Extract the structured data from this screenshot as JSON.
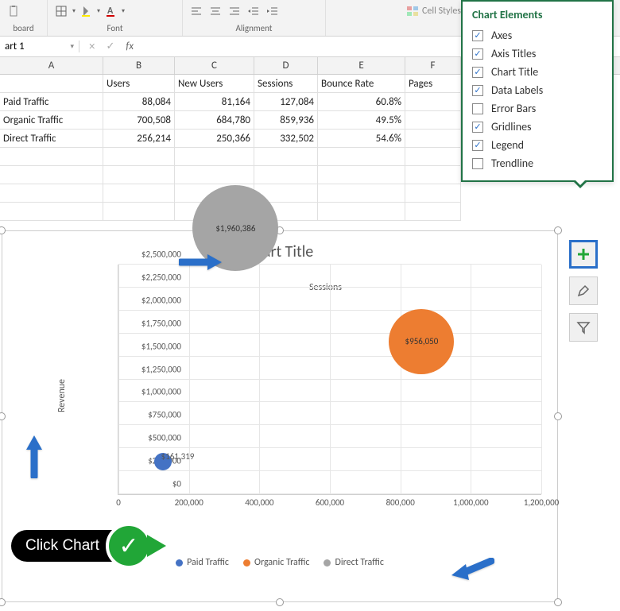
{
  "ribbon": {
    "group1_label": "board",
    "group2_label": "Font",
    "group3_label": "Alignment",
    "cell_styles_label": "Cell Styles"
  },
  "formula_bar": {
    "name_box": "art 1",
    "fx_label": "fx"
  },
  "columns": [
    "A",
    "B",
    "C",
    "D",
    "E",
    "F"
  ],
  "table": {
    "headers": [
      "",
      "Users",
      "New Users",
      "Sessions",
      "Bounce Rate",
      "Pages"
    ],
    "rows": [
      [
        "Paid Traffic",
        "88,084",
        "81,164",
        "127,084",
        "60.8%",
        ""
      ],
      [
        "Organic Traffic",
        "700,508",
        "684,780",
        "859,936",
        "49.5%",
        ""
      ],
      [
        "Direct Traffic",
        "256,214",
        "250,366",
        "332,502",
        "54.6%",
        ""
      ]
    ]
  },
  "flyout": {
    "title": "Chart Elements",
    "items": [
      {
        "label": "Axes",
        "checked": true
      },
      {
        "label": "Axis Titles",
        "checked": true
      },
      {
        "label": "Chart Title",
        "checked": true
      },
      {
        "label": "Data Labels",
        "checked": true
      },
      {
        "label": "Error Bars",
        "checked": false
      },
      {
        "label": "Gridlines",
        "checked": true
      },
      {
        "label": "Legend",
        "checked": true
      },
      {
        "label": "Trendline",
        "checked": false
      }
    ]
  },
  "chart": {
    "title": "Chart Title",
    "x_axis_title": "Sessions",
    "y_axis_title": "Revenue",
    "y_ticks": [
      "$0",
      "$250,000",
      "$500,000",
      "$750,000",
      "$1,000,000",
      "$1,250,000",
      "$1,500,000",
      "$1,750,000",
      "$2,000,000",
      "$2,250,000",
      "$2,500,000"
    ],
    "x_ticks": [
      "0",
      "200,000",
      "400,000",
      "600,000",
      "800,000",
      "1,000,000",
      "1,200,000"
    ],
    "legend": [
      "Paid Traffic",
      "Organic Traffic",
      "Direct Traffic"
    ],
    "data_labels": {
      "paid": "$161,319",
      "organic": "$956,050",
      "direct": "$1,960,386"
    }
  },
  "click_label": "Click Chart",
  "chart_data": {
    "type": "scatter",
    "subtype": "bubble",
    "title": "Chart Title",
    "xlabel": "Sessions",
    "ylabel": "Revenue",
    "xlim": [
      0,
      1200000
    ],
    "ylim": [
      0,
      2500000
    ],
    "series": [
      {
        "name": "Paid Traffic",
        "color": "#4472c4",
        "x": 127084,
        "y": 161319,
        "label": "$161,319",
        "size_rank": 1
      },
      {
        "name": "Organic Traffic",
        "color": "#ed7d31",
        "x": 859936,
        "y": 956050,
        "label": "$956,050",
        "size_rank": 2
      },
      {
        "name": "Direct Traffic",
        "color": "#a5a5a5",
        "x": 332502,
        "y": 1960386,
        "label": "$1,960,386",
        "size_rank": 3
      }
    ],
    "legend_position": "bottom",
    "grid": true
  }
}
